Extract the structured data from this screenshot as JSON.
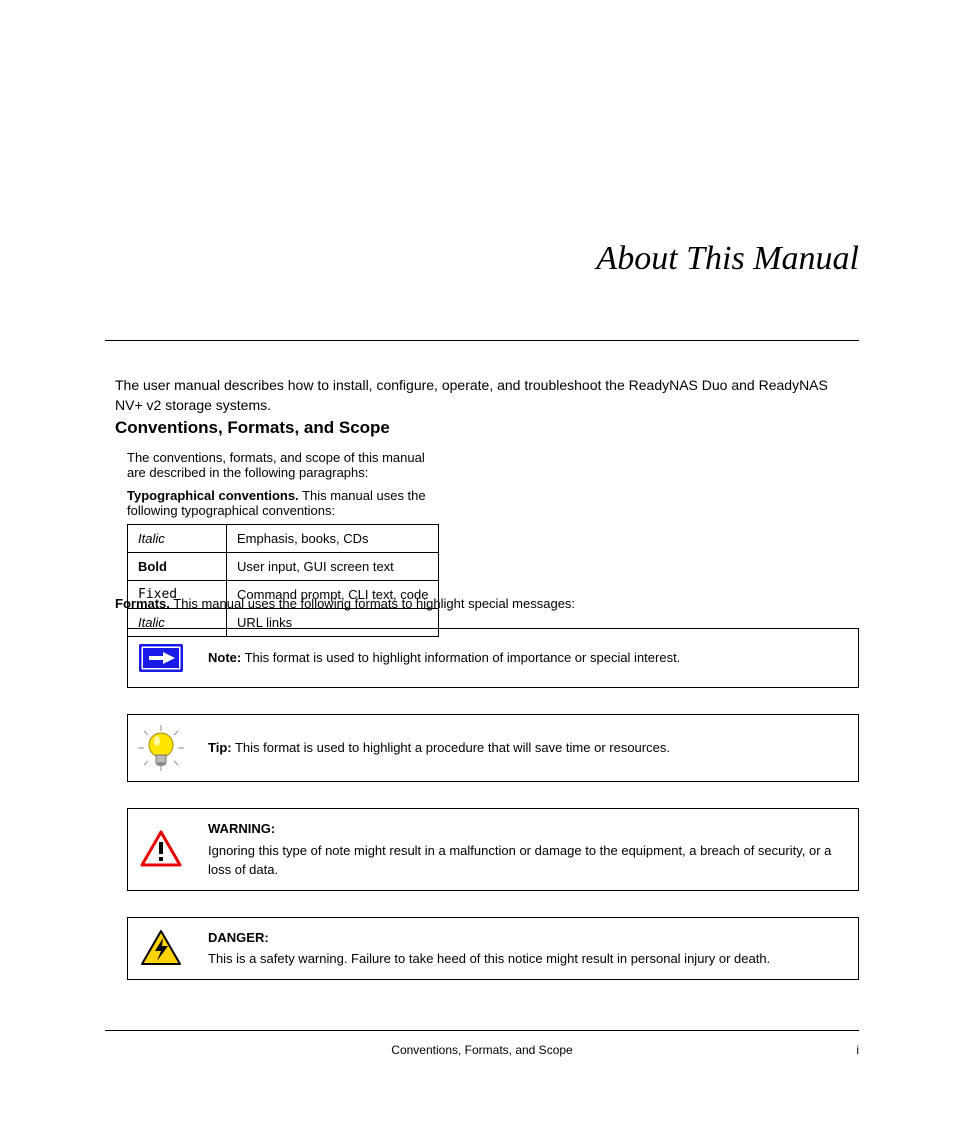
{
  "title": "About This Manual",
  "intro": "The user manual describes how to install, configure, operate, and troubleshoot the ReadyNAS Duo and ReadyNAS NV+ v2 storage systems.",
  "conventions_heading": "Conventions, Formats, and Scope",
  "conventions_intro": "The conventions, formats, and scope of this manual are described in the following paragraphs:",
  "conventions_lead": "Typographical conventions.",
  "conventions_lead_after": " This manual uses the following typographical conventions:",
  "table": {
    "rows": [
      [
        "Italic",
        "Emphasis, books, CDs"
      ],
      [
        "Bold",
        "User input, GUI screen text"
      ],
      [
        "Fixed",
        "Command prompt, CLI text, code"
      ],
      [
        "Italic",
        "URL links"
      ]
    ]
  },
  "formats_lead": "Formats.",
  "formats_lead_after": " This manual uses the following formats to highlight special messages:",
  "callouts": [
    {
      "icon": "arrow",
      "lead": "Note:",
      "text": " This format is used to highlight information of importance or special interest."
    },
    {
      "icon": "bulb",
      "lead": "Tip:",
      "text": " This format is used to highlight a procedure that will save time or resources."
    },
    {
      "icon": "warning",
      "lead": "WARNING:",
      "text": "Ignoring this type of note might result in a malfunction or damage to the equipment, a breach of security, or a loss of data."
    },
    {
      "icon": "danger",
      "lead": "DANGER:",
      "text": "This is a safety warning. Failure to take heed of this notice might result in personal injury or death."
    }
  ],
  "footer": "Conventions, Formats, and Scope",
  "pagenum": "i"
}
